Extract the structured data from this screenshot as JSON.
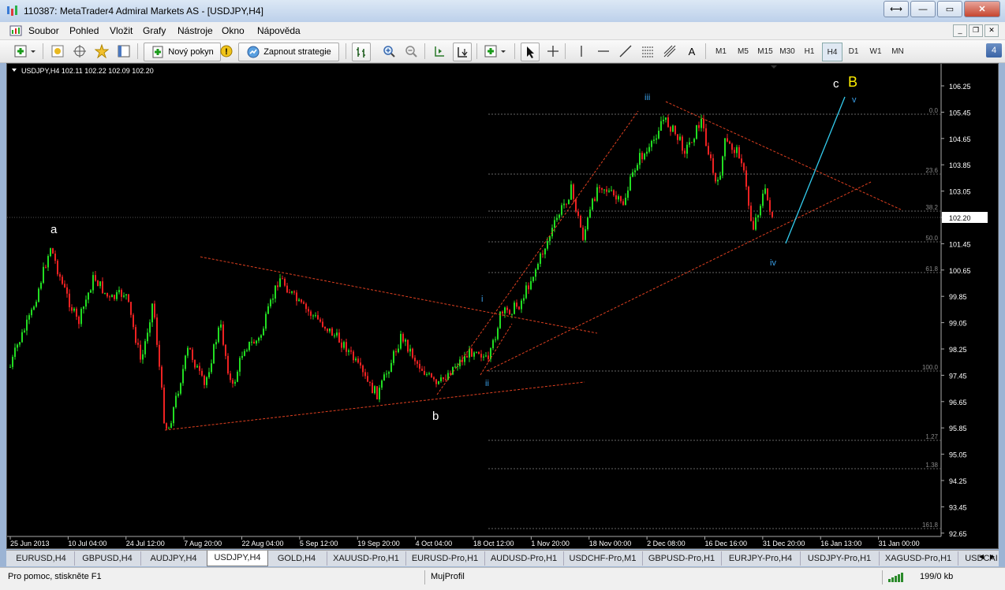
{
  "window": {
    "title": "110387: MetaTrader4 Admiral Markets AS - [USDJPY,H4]"
  },
  "menu": [
    "Soubor",
    "Pohled",
    "Vložit",
    "Grafy",
    "Nástroje",
    "Okno",
    "Nápověda"
  ],
  "toolbar": {
    "new_order_label": "Nový pokyn",
    "autotrade_label": "Zapnout strategie",
    "text_tool": "A",
    "timeframes": [
      "M1",
      "M5",
      "M15",
      "M30",
      "H1",
      "H4",
      "D1",
      "W1",
      "MN"
    ],
    "active_timeframe": "H4",
    "notification_count": "4"
  },
  "chart": {
    "header": "USDJPY,H4  102.11 102.22 102.09 102.20",
    "current_price": "102.20",
    "price_axis": [
      "106.25",
      "105.45",
      "104.65",
      "103.85",
      "103.05",
      "102.20",
      "101.45",
      "100.65",
      "99.85",
      "99.05",
      "98.25",
      "97.45",
      "96.65",
      "95.85",
      "95.05",
      "94.25",
      "93.45",
      "92.65"
    ],
    "time_axis": [
      "25 Jun 2013",
      "10 Jul 04:00",
      "24 Jul 12:00",
      "7 Aug 20:00",
      "22 Aug 04:00",
      "5 Sep 12:00",
      "19 Sep 20:00",
      "4 Oct 04:00",
      "18 Oct 12:00",
      "1 Nov 20:00",
      "18 Nov 00:00",
      "2 Dec 08:00",
      "16 Dec 16:00",
      "31 Dec 20:00",
      "16 Jan 13:00",
      "31 Jan 00:00"
    ],
    "fib_levels": [
      "0.0",
      "23.6",
      "38.2",
      "50.0",
      "61.8",
      "100.0",
      "1.27",
      "1.38",
      "161.8"
    ],
    "wave_labels": {
      "a": "a",
      "b": "b",
      "c": "c",
      "B": "B",
      "i": "i",
      "ii": "ii",
      "iii": "iii",
      "iv": "iv",
      "v": "v"
    },
    "colors": {
      "bull": "#22dd22",
      "bear": "#ee2222",
      "trendline": "#e04020",
      "projection": "#33ccee",
      "wave_minor": "#3aa0e8",
      "wave_major_label": "#ffffff",
      "wave_B": "#ffee00"
    }
  },
  "tabs": [
    "EURUSD,H4",
    "GBPUSD,H4",
    "AUDJPY,H4",
    "USDJPY,H4",
    "GOLD,H4",
    "XAUUSD-Pro,H1",
    "EURUSD-Pro,H1",
    "AUDUSD-Pro,H1",
    "USDCHF-Pro,M1",
    "GBPUSD-Pro,H1",
    "EURJPY-Pro,H4",
    "USDJPY-Pro,H1",
    "XAGUSD-Pro,H1",
    "USDCAI"
  ],
  "active_tab": "USDJPY,H4",
  "status": {
    "help": "Pro pomoc, stiskněte F1",
    "profile": "MujProfil",
    "traffic": "199/0 kb"
  }
}
